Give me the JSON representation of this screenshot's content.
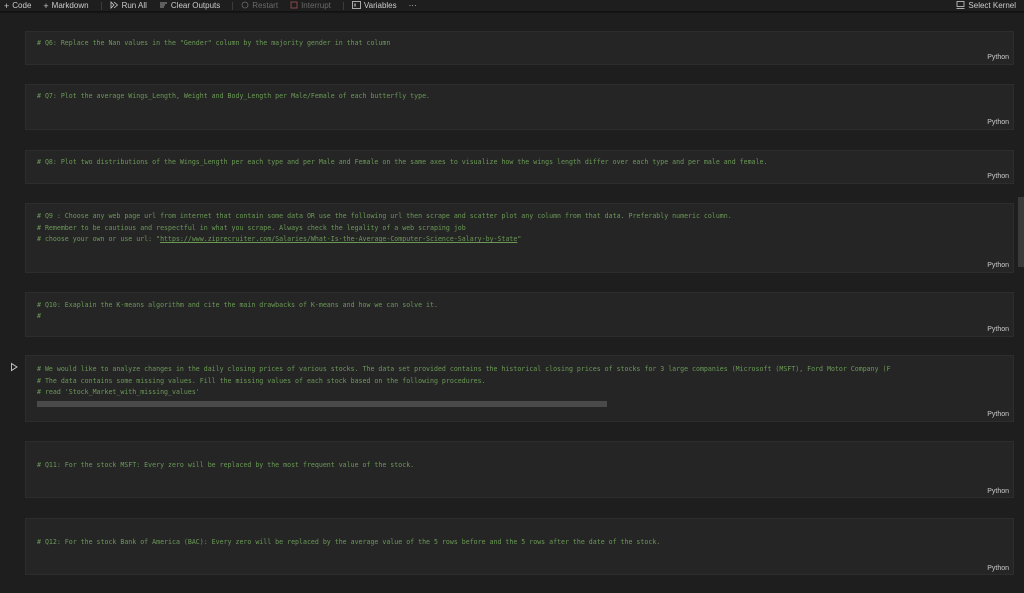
{
  "toolbar": {
    "code": "Code",
    "markdown": "Markdown",
    "run_all": "Run All",
    "clear_outputs": "Clear Outputs",
    "restart": "Restart",
    "interrupt": "Interrupt",
    "variables": "Variables",
    "more": "···",
    "select_kernel": "Select Kernel"
  },
  "cells": [
    {
      "lines": [
        "# Q6: Replace the Nan values in the \"Gender\" column by the majority gender in that column"
      ],
      "lang": "Python"
    },
    {
      "lines": [
        "# Q7: Plot the average Wings_Length, Weight and Body_Length per Male/Female of each butterfly type."
      ],
      "lang": "Python"
    },
    {
      "lines": [
        "# Q8: Plot two distributions of the Wings_Length per each type and per Male and Female on the same axes to visualize how the wings length differ over each type and per male and female."
      ],
      "lang": "Python"
    },
    {
      "lines": [
        "# Q9 : Choose any web page url from internet that contain some data OR use the following url then scrape and scatter plot any column from that data. Preferably numeric column.",
        "# Remember to be cautious and respectful in what you scrape. Always check the legality of a web scraping job",
        "# choose your own or use url: \""
      ],
      "url": "https://www.ziprecruiter.com/Salaries/What-Is-the-Average-Computer-Science-Salary-by-State",
      "url_suffix": "\"",
      "lang": "Python"
    },
    {
      "lines": [
        "# Q10: Exaplain the K-means algorithm and cite the main drawbacks of K-means and how we can solve it.",
        "#"
      ],
      "lang": "Python"
    },
    {
      "lines": [
        "# We would like to analyze changes in the daily closing prices of various stocks. The data set provided contains the historical closing prices of stocks for 3 large companies (Microsoft (MSFT), Ford Motor Company (F",
        "# The data contains some missing values. Fill the missing values of each stock based on the following procedures.",
        "# read 'Stock_Market_with_missing_values'"
      ],
      "lang": "Python"
    },
    {
      "lines": [
        "# Q11: For the stock MSFT: Every zero will be replaced by the most frequent value of the stock."
      ],
      "lang": "Python"
    },
    {
      "lines": [
        "# Q12: For the stock Bank of America (BAC): Every zero will be replaced by the average value of the 5 rows before and the 5 rows after the date of the stock."
      ],
      "lang": "Python"
    }
  ]
}
